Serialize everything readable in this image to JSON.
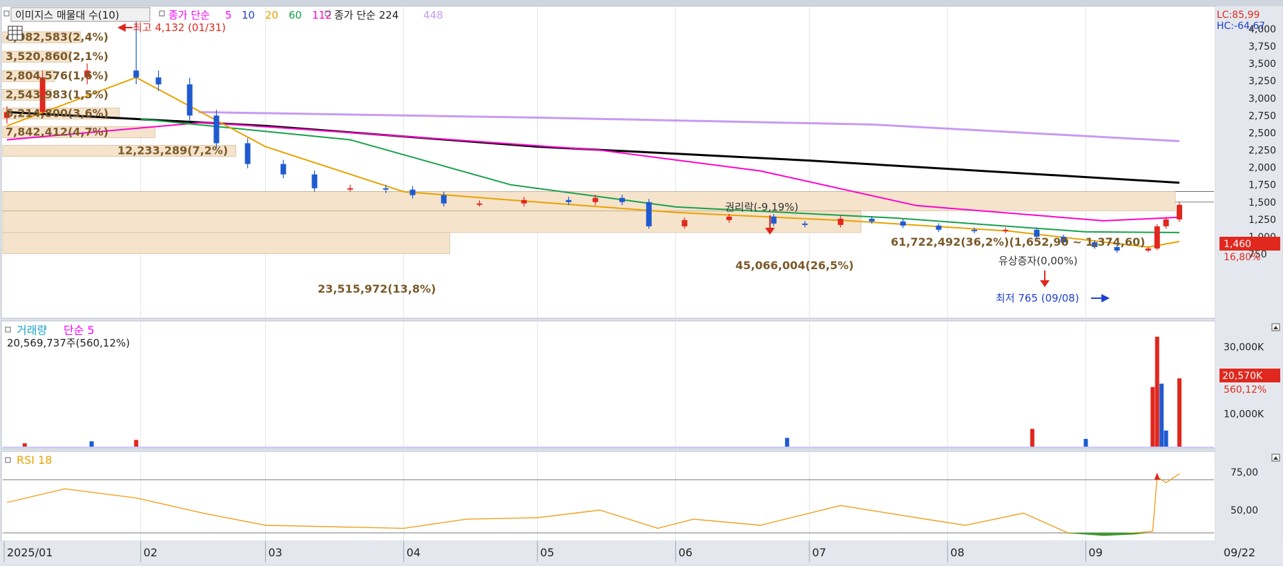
{
  "main_legend": {
    "title": "이미지스 매물대 수(10)",
    "ma_label": "종가 단순",
    "ma_periods": [
      {
        "label": "5",
        "color": "#ff00ff"
      },
      {
        "label": "10",
        "color": "#1f3fcf"
      },
      {
        "label": "20",
        "color": "#e8a200"
      },
      {
        "label": "60",
        "color": "#16a04a"
      },
      {
        "label": "112",
        "color": "#ff00cc"
      }
    ],
    "ma2_label": "종가 단순 224",
    "ma2_extra": "448",
    "ma2_extra_color": "#c79bf2"
  },
  "price_axis": {
    "ticks": [
      "4,000",
      "3,750",
      "3,500",
      "3,250",
      "3,000",
      "2,750",
      "2,500",
      "2,250",
      "2,000",
      "1,750",
      "1,500",
      "1,250",
      "1,000",
      "750"
    ],
    "lc_label": "LC:85,99",
    "hc_label": "HC:-64,67",
    "last_price": "1,460",
    "last_change": "16,80%"
  },
  "annotations": {
    "high": "최고 4,132 (01/31)",
    "low": "최저 765 (09/08)",
    "rights": "권리락(-9,19%)",
    "capital_increase": "유상증자(0,00%)"
  },
  "volume_profile": [
    {
      "label": "4,082,583(2,4%)"
    },
    {
      "label": "3,520,860(2,1%)"
    },
    {
      "label": "2,804,576(1,6%)"
    },
    {
      "label": "2,543,983(1,5%)"
    },
    {
      "label": "6,214,800(3,6%)"
    },
    {
      "label": "7,842,412(4,7%)"
    },
    {
      "label": "12,233,289(7,2%)"
    },
    {
      "label": "61,722,492(36,2%)(1,652,90 ~ 1,374,60)"
    },
    {
      "label": "45,066,004(26,5%)"
    },
    {
      "label": "23,515,972(13,8%)"
    }
  ],
  "volume_panel": {
    "title": "거래량",
    "ma_label": "단순 5",
    "value_text": "20,569,737주(560,12%)",
    "ticks": [
      "30,000K",
      "10,000K"
    ],
    "last_value": "20,570K",
    "last_pct": "560,12%"
  },
  "rsi_panel": {
    "title": "RSI 18",
    "ticks": [
      "75,00",
      "50,00"
    ]
  },
  "x_axis": {
    "labels": [
      "2025/01",
      "02",
      "03",
      "04",
      "05",
      "06",
      "07",
      "08",
      "09",
      "09/22"
    ]
  },
  "chart_data": [
    {
      "type": "candlestick",
      "title": "이미지스",
      "xlabel": "",
      "ylabel": "",
      "x_range": [
        "2025-01-02",
        "2025-09-22"
      ],
      "ylim": [
        750,
        4000
      ],
      "close_points": [
        {
          "date": "2025-01-02",
          "close": 2800
        },
        {
          "date": "2025-01-10",
          "close": 3300
        },
        {
          "date": "2025-01-20",
          "close": 3400
        },
        {
          "date": "2025-01-31",
          "close": 3300,
          "high": 4132
        },
        {
          "date": "2025-02-05",
          "close": 3200
        },
        {
          "date": "2025-02-12",
          "close": 2750
        },
        {
          "date": "2025-02-18",
          "close": 2350
        },
        {
          "date": "2025-02-25",
          "close": 2050
        },
        {
          "date": "2025-03-05",
          "close": 1900
        },
        {
          "date": "2025-03-12",
          "close": 1700
        },
        {
          "date": "2025-03-20",
          "close": 1700
        },
        {
          "date": "2025-03-28",
          "close": 1680
        },
        {
          "date": "2025-04-03",
          "close": 1600
        },
        {
          "date": "2025-04-10",
          "close": 1480
        },
        {
          "date": "2025-04-18",
          "close": 1480
        },
        {
          "date": "2025-04-28",
          "close": 1530
        },
        {
          "date": "2025-05-08",
          "close": 1500
        },
        {
          "date": "2025-05-14",
          "close": 1560
        },
        {
          "date": "2025-05-20",
          "close": 1500
        },
        {
          "date": "2025-05-26",
          "close": 1150
        },
        {
          "date": "2025-06-03",
          "close": 1240
        },
        {
          "date": "2025-06-13",
          "close": 1290
        },
        {
          "date": "2025-06-23",
          "close": 1190
        },
        {
          "date": "2025-06-30",
          "close": 1170
        },
        {
          "date": "2025-07-08",
          "close": 1260
        },
        {
          "date": "2025-07-15",
          "close": 1220
        },
        {
          "date": "2025-07-22",
          "close": 1160
        },
        {
          "date": "2025-07-30",
          "close": 1100
        },
        {
          "date": "2025-08-07",
          "close": 1080
        },
        {
          "date": "2025-08-14",
          "close": 1100
        },
        {
          "date": "2025-08-21",
          "close": 1000
        },
        {
          "date": "2025-08-27",
          "close": 920
        },
        {
          "date": "2025-09-03",
          "close": 850
        },
        {
          "date": "2025-09-08",
          "close": 800,
          "low": 765
        },
        {
          "date": "2025-09-15",
          "close": 830
        },
        {
          "date": "2025-09-17",
          "close": 1150
        },
        {
          "date": "2025-09-19",
          "close": 1250
        },
        {
          "date": "2025-09-22",
          "close": 1460
        }
      ],
      "series": [
        {
          "name": "224",
          "color": "#000000",
          "values": [
            {
              "date": "2025-01-02",
              "value": 2800
            },
            {
              "date": "2025-03-01",
              "value": 2600
            },
            {
              "date": "2025-05-01",
              "value": 2300
            },
            {
              "date": "2025-07-01",
              "value": 2100
            },
            {
              "date": "2025-09-22",
              "value": 1780
            }
          ]
        },
        {
          "name": "448",
          "color": "#c79bf2",
          "values": [
            {
              "date": "2025-02-14",
              "value": 2800
            },
            {
              "date": "2025-05-01",
              "value": 2720
            },
            {
              "date": "2025-07-15",
              "value": 2620
            },
            {
              "date": "2025-09-22",
              "value": 2380
            }
          ]
        },
        {
          "name": "112",
          "color": "#ff00cc",
          "values": [
            {
              "date": "2025-01-02",
              "value": 2400
            },
            {
              "date": "2025-02-15",
              "value": 2650
            },
            {
              "date": "2025-04-01",
              "value": 2450
            },
            {
              "date": "2025-05-15",
              "value": 2250
            },
            {
              "date": "2025-06-20",
              "value": 1950
            },
            {
              "date": "2025-07-25",
              "value": 1450
            },
            {
              "date": "2025-09-05",
              "value": 1230
            },
            {
              "date": "2025-09-22",
              "value": 1280
            }
          ]
        },
        {
          "name": "60",
          "color": "#16a04a",
          "values": [
            {
              "date": "2025-02-01",
              "value": 2700
            },
            {
              "date": "2025-03-20",
              "value": 2400
            },
            {
              "date": "2025-04-25",
              "value": 1750
            },
            {
              "date": "2025-06-01",
              "value": 1430
            },
            {
              "date": "2025-07-20",
              "value": 1270
            },
            {
              "date": "2025-09-01",
              "value": 1070
            },
            {
              "date": "2025-09-22",
              "value": 1060
            }
          ]
        },
        {
          "name": "20",
          "color": "#e8a200",
          "values": [
            {
              "date": "2025-01-02",
              "value": 2600
            },
            {
              "date": "2025-01-31",
              "value": 3300
            },
            {
              "date": "2025-03-01",
              "value": 2300
            },
            {
              "date": "2025-04-01",
              "value": 1650
            },
            {
              "date": "2025-05-01",
              "value": 1500
            },
            {
              "date": "2025-06-01",
              "value": 1350
            },
            {
              "date": "2025-07-10",
              "value": 1230
            },
            {
              "date": "2025-08-15",
              "value": 1080
            },
            {
              "date": "2025-09-15",
              "value": 850
            },
            {
              "date": "2025-09-22",
              "value": 930
            }
          ]
        }
      ],
      "volume_profile_bars": [
        {
          "range": [
            3960,
            3800
          ],
          "pct": 2.4
        },
        {
          "range": [
            3680,
            3520
          ],
          "pct": 2.1
        },
        {
          "range": [
            3400,
            3240
          ],
          "pct": 1.6
        },
        {
          "range": [
            3130,
            2970
          ],
          "pct": 1.5
        },
        {
          "range": [
            2860,
            2700
          ],
          "pct": 3.6
        },
        {
          "range": [
            2590,
            2430
          ],
          "pct": 4.7
        },
        {
          "range": [
            2320,
            2160
          ],
          "pct": 7.2
        },
        {
          "range": [
            1652.9,
            1374.6
          ],
          "pct": 36.2
        },
        {
          "range": [
            1370,
            1060
          ],
          "pct": 26.5
        },
        {
          "range": [
            1060,
            755
          ],
          "pct": 13.8
        }
      ]
    },
    {
      "type": "bar",
      "title": "거래량",
      "ylim": [
        0,
        34000
      ],
      "units": "K",
      "values": [
        {
          "date": "2025-01-06",
          "value": 1200
        },
        {
          "date": "2025-01-21",
          "value": 1800
        },
        {
          "date": "2025-01-31",
          "value": 2200
        },
        {
          "date": "2025-06-26",
          "value": 2800
        },
        {
          "date": "2025-08-20",
          "value": 5500
        },
        {
          "date": "2025-09-01",
          "value": 2500
        },
        {
          "date": "2025-09-16",
          "value": 18000
        },
        {
          "date": "2025-09-17",
          "value": 33000
        },
        {
          "date": "2025-09-18",
          "value": 19000
        },
        {
          "date": "2025-09-19",
          "value": 5000
        },
        {
          "date": "2025-09-22",
          "value": 20570
        }
      ]
    },
    {
      "type": "line",
      "title": "RSI 18",
      "ylim": [
        30,
        80
      ],
      "values": [
        {
          "date": "2025-01-02",
          "value": 55
        },
        {
          "date": "2025-01-15",
          "value": 64
        },
        {
          "date": "2025-01-31",
          "value": 58
        },
        {
          "date": "2025-02-15",
          "value": 48
        },
        {
          "date": "2025-03-01",
          "value": 40
        },
        {
          "date": "2025-04-01",
          "value": 38
        },
        {
          "date": "2025-04-15",
          "value": 44
        },
        {
          "date": "2025-05-01",
          "value": 45
        },
        {
          "date": "2025-05-15",
          "value": 50
        },
        {
          "date": "2025-05-28",
          "value": 38
        },
        {
          "date": "2025-06-05",
          "value": 44
        },
        {
          "date": "2025-06-20",
          "value": 40
        },
        {
          "date": "2025-07-08",
          "value": 53
        },
        {
          "date": "2025-07-25",
          "value": 45
        },
        {
          "date": "2025-08-05",
          "value": 40
        },
        {
          "date": "2025-08-18",
          "value": 48
        },
        {
          "date": "2025-08-28",
          "value": 35
        },
        {
          "date": "2025-09-05",
          "value": 34
        },
        {
          "date": "2025-09-12",
          "value": 35
        },
        {
          "date": "2025-09-16",
          "value": 36
        },
        {
          "date": "2025-09-17",
          "value": 72
        },
        {
          "date": "2025-09-19",
          "value": 68
        },
        {
          "date": "2025-09-22",
          "value": 74
        }
      ]
    }
  ]
}
